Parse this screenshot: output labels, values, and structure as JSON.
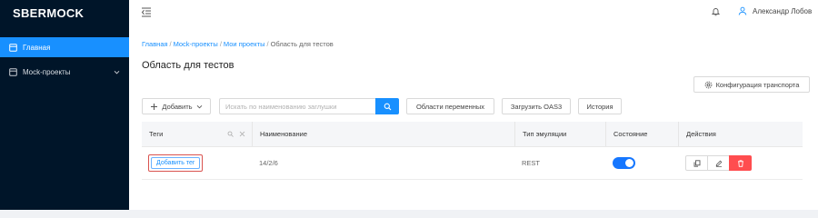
{
  "app": {
    "logo": "SBERMOCK"
  },
  "sidebar": {
    "items": [
      {
        "label": "Главная",
        "icon": "home-icon",
        "active": true
      },
      {
        "label": "Mock-проекты",
        "icon": "projects-icon",
        "active": false,
        "expandable": true
      }
    ]
  },
  "header": {
    "user_name": "Александр Лобов",
    "icons": [
      "menu-fold-icon",
      "bell-icon",
      "user-icon"
    ]
  },
  "breadcrumb": {
    "links": [
      "Главная",
      "Mock-проекты",
      "Мои проекты"
    ],
    "current": "Область для тестов",
    "separator": "/"
  },
  "page": {
    "title": "Область для тестов"
  },
  "toolbar": {
    "transport_config_label": "Конфигурация транспорта",
    "add_label": "Добавить",
    "search_placeholder": "Искать по наименованию заглушки",
    "search_value": "",
    "variables_scopes_label": "Области переменных",
    "upload_oas3_label": "Загрузить OAS3",
    "history_label": "История"
  },
  "table": {
    "columns": [
      "Теги",
      "Наименование",
      "Тип эмуляции",
      "Состояние",
      "Действия"
    ],
    "rows": [
      {
        "tag_button": "Добавить тег",
        "name": "14/2/6",
        "emulation_type": "REST",
        "state_on": true
      }
    ]
  },
  "colors": {
    "sidebar_bg": "#001529",
    "primary": "#1890ff",
    "danger": "#ff4d4f",
    "highlight_border": "#d9534f"
  }
}
